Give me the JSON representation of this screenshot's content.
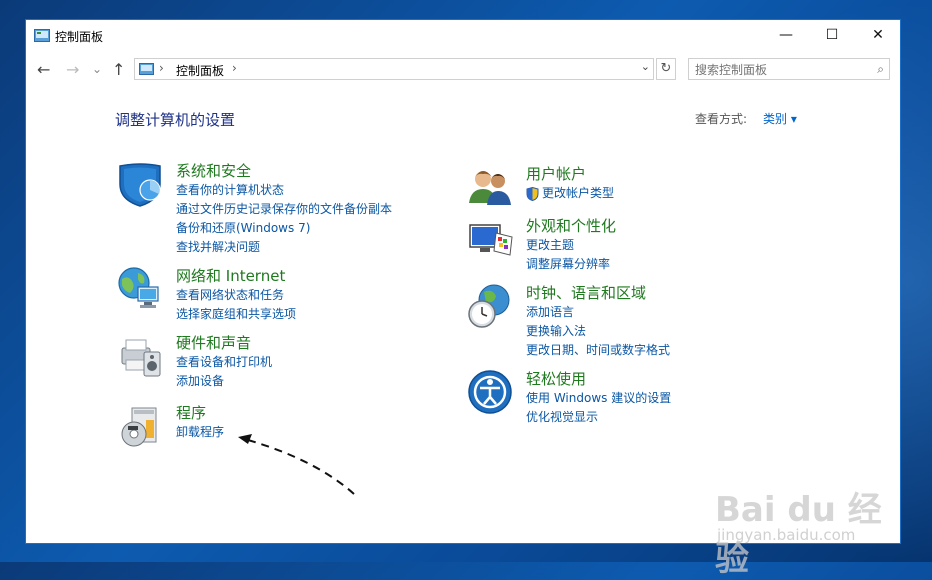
{
  "window": {
    "title": "控制面板",
    "minimize": "—",
    "maximize": "☐",
    "close": "✕"
  },
  "nav": {
    "back": "←",
    "forward": "→",
    "recent": "⌄",
    "up": "↑",
    "address": "控制面板",
    "search_placeholder": "搜索控制面板"
  },
  "page": {
    "title": "调整计算机的设置",
    "view_by_label": "查看方式:",
    "view_by_value": "类别 ▾"
  },
  "categories_left": [
    {
      "name": "系统和安全",
      "icon": "shield-icon",
      "links": [
        "查看你的计算机状态",
        "通过文件历史记录保存你的文件备份副本",
        "备份和还原(Windows 7)",
        "查找并解决问题"
      ]
    },
    {
      "name": "网络和 Internet",
      "icon": "network-globe-icon",
      "links": [
        "查看网络状态和任务",
        "选择家庭组和共享选项"
      ]
    },
    {
      "name": "硬件和声音",
      "icon": "printer-speaker-icon",
      "links": [
        "查看设备和打印机",
        "添加设备"
      ]
    },
    {
      "name": "程序",
      "icon": "programs-disc-icon",
      "links": [
        "卸载程序"
      ]
    }
  ],
  "categories_right": [
    {
      "name": "用户帐户",
      "icon": "users-icon",
      "links": [
        "更改帐户类型"
      ]
    },
    {
      "name": "外观和个性化",
      "icon": "monitor-palette-icon",
      "links": [
        "更改主题",
        "调整屏幕分辨率"
      ]
    },
    {
      "name": "时钟、语言和区域",
      "icon": "clock-globe-icon",
      "links": [
        "添加语言",
        "更换输入法",
        "更改日期、时间或数字格式"
      ]
    },
    {
      "name": "轻松使用",
      "icon": "ease-of-access-icon",
      "links": [
        "使用 Windows 建议的设置",
        "优化视觉显示"
      ]
    }
  ],
  "watermark": {
    "brand": "Bai du 经验",
    "url": "jingyan.baidu.com"
  },
  "colors": {
    "category_title": "#1f7a1f",
    "link": "#0b57a4",
    "page_title": "#1e3287",
    "accent": "#0066cc"
  }
}
